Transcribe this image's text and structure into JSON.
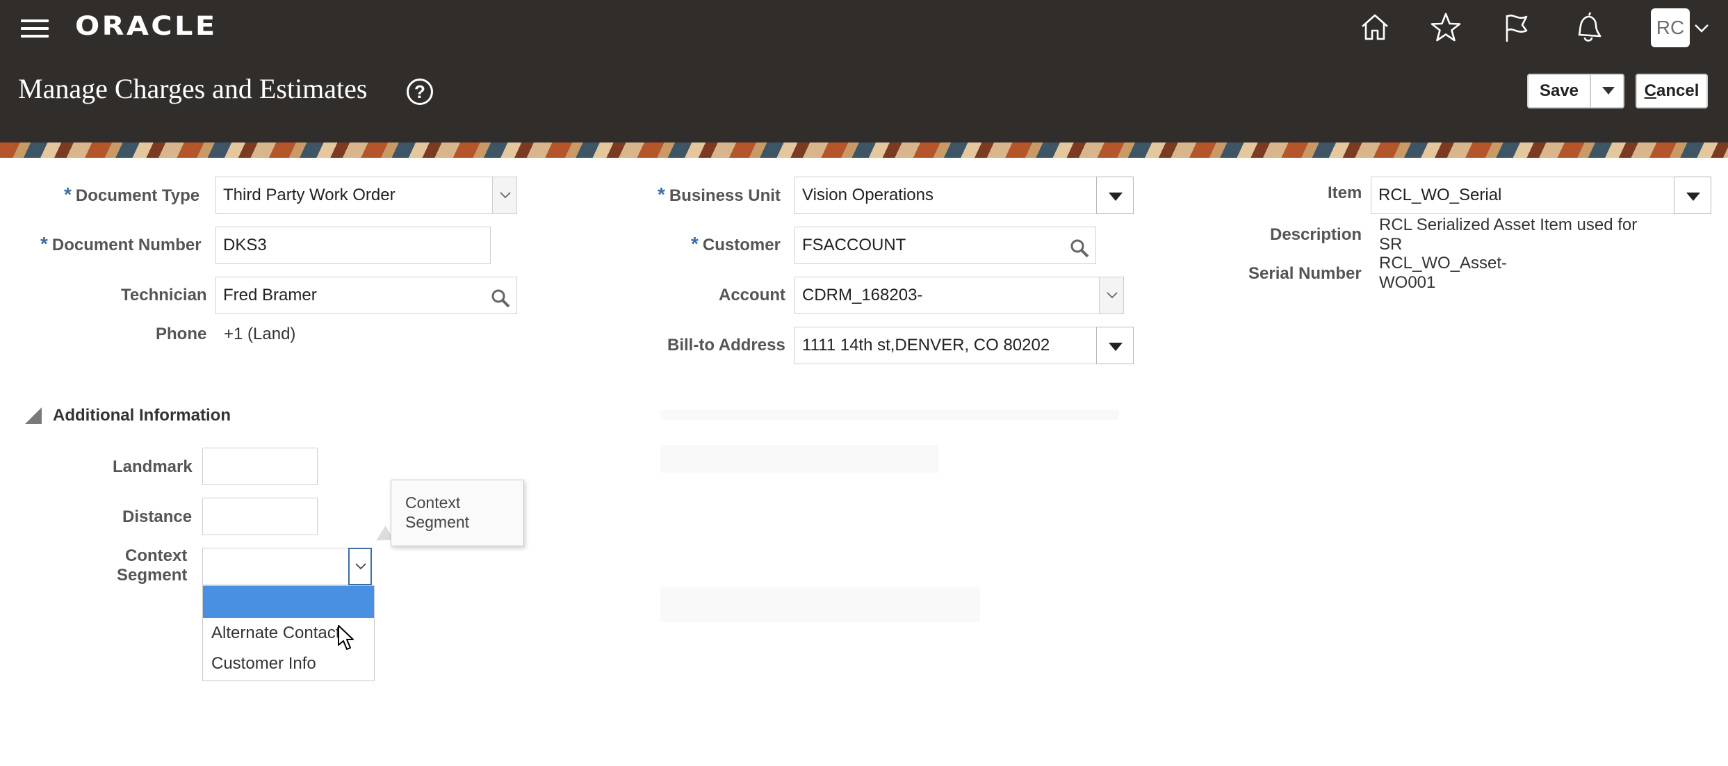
{
  "header": {
    "logo": "ORACLE",
    "page_title": "Manage Charges and Estimates",
    "help_symbol": "?",
    "avatar_initials": "RC",
    "save_label": "Save",
    "cancel_label": "Cancel",
    "icons": [
      "home-icon",
      "favorites-icon",
      "watchlist-flag-icon",
      "notifications-bell-icon"
    ]
  },
  "form": {
    "document_type": {
      "label": "Document Type",
      "value": "Third Party Work Order"
    },
    "document_number": {
      "label": "Document Number",
      "value": "DKS3"
    },
    "technician": {
      "label": "Technician",
      "value": "Fred Bramer"
    },
    "phone": {
      "label": "Phone",
      "value": "+1 (Land)"
    },
    "business_unit": {
      "label": "Business Unit",
      "value": "Vision Operations"
    },
    "customer": {
      "label": "Customer",
      "value": "FSACCOUNT"
    },
    "account": {
      "label": "Account",
      "value": "CDRM_168203-"
    },
    "bill_to_address": {
      "label": "Bill-to Address",
      "value": "1111 14th st,DENVER, CO 80202"
    },
    "item": {
      "label": "Item",
      "value": "RCL_WO_Serial"
    },
    "description": {
      "label": "Description",
      "line1": "RCL Serialized Asset Item used for",
      "line2": "SR"
    },
    "serial_number": {
      "label": "Serial Number",
      "line1": "RCL_WO_Asset-",
      "line2": "WO001"
    },
    "required_marker": "*"
  },
  "additional_info": {
    "title": "Additional Information",
    "landmark_label": "Landmark",
    "distance_label": "Distance",
    "context_segment_label_1": "Context",
    "context_segment_label_2": "Segment",
    "tooltip_line1": "Context",
    "tooltip_line2": "Segment",
    "options": [
      "",
      "Alternate Contact",
      "Customer Info"
    ]
  },
  "colors": {
    "header_bg": "#312d2a",
    "required": "#3a6ea5",
    "selected_option": "#4a90e2"
  }
}
